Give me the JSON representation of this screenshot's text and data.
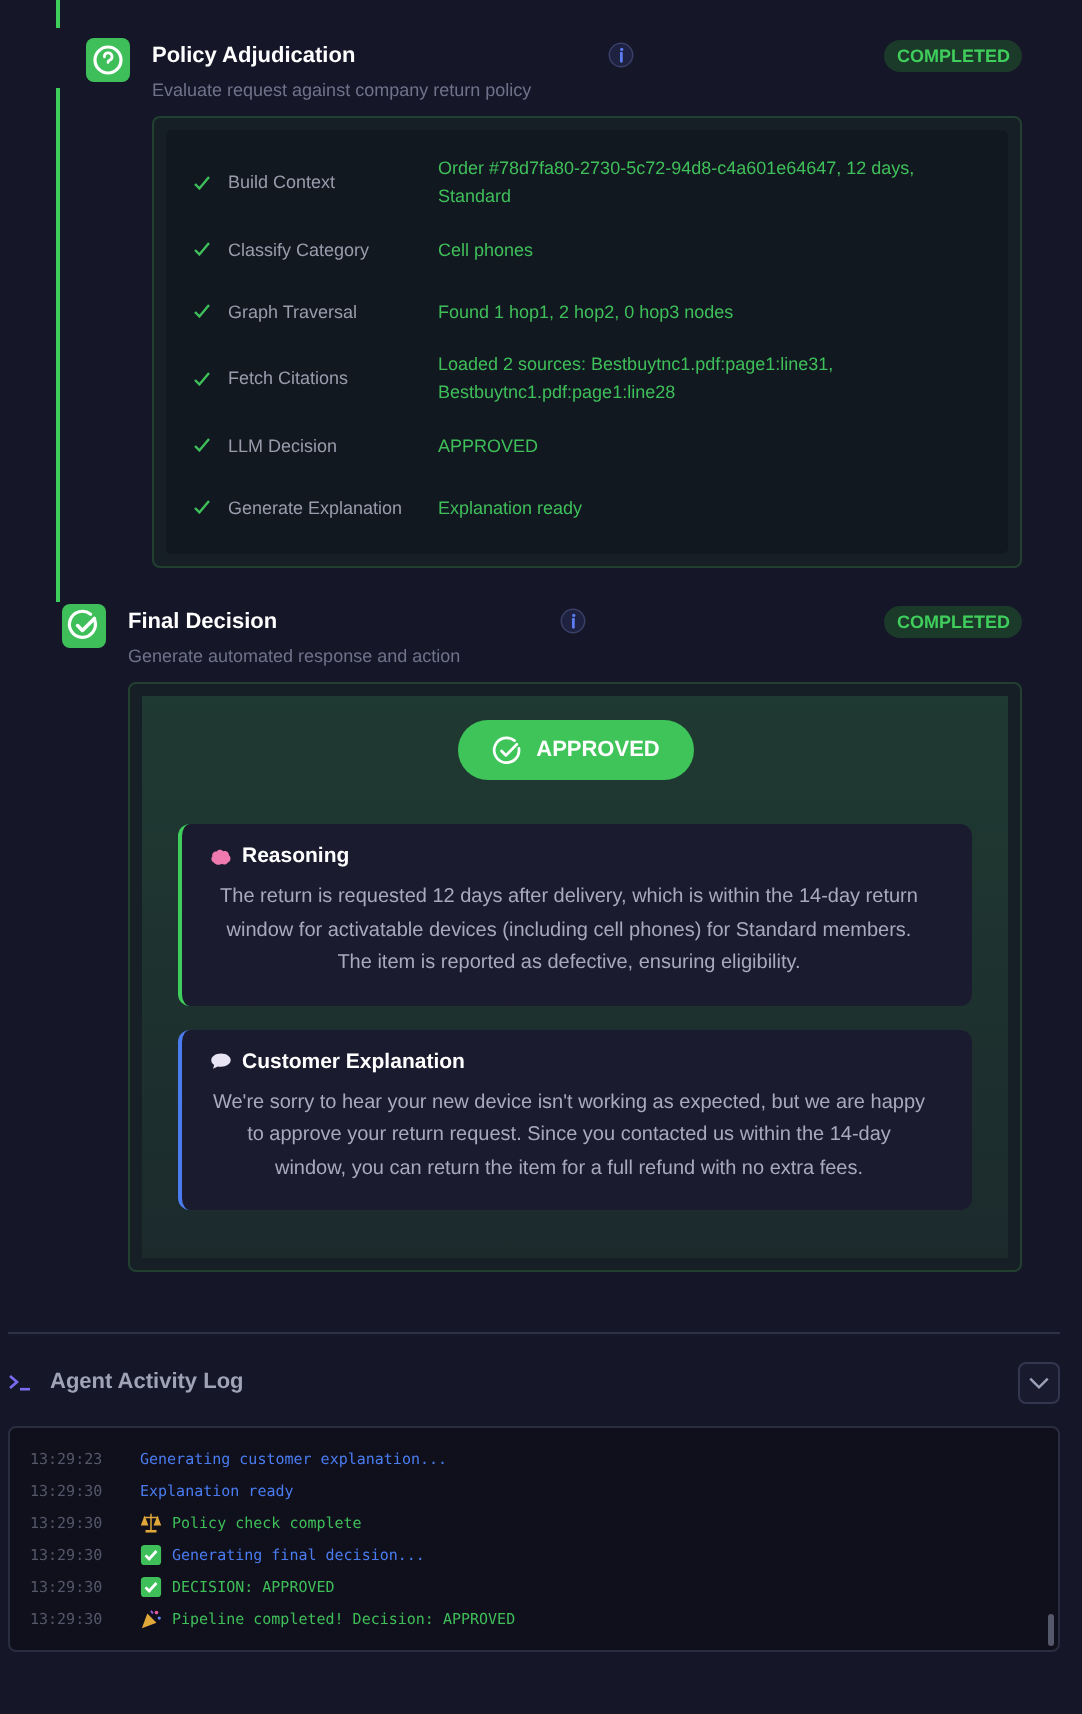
{
  "steps": [
    {
      "kind": "policy",
      "title": "Policy Adjudication",
      "subtitle": "Evaluate request against company return policy",
      "status": "COMPLETED",
      "rows": [
        {
          "done": true,
          "label": "Build Context",
          "value": "Order #78d7fa80-2730-5c72-94d8-c4a601e64647, 12 days, Standard"
        },
        {
          "done": true,
          "label": "Classify Category",
          "value": "Cell phones"
        },
        {
          "done": true,
          "label": "Graph Traversal",
          "value": "Found 1 hop1, 2 hop2, 0 hop3 nodes"
        },
        {
          "done": true,
          "label": "Fetch Citations",
          "value": "Loaded 2 sources: Bestbuytnc1.pdf:page1:line31, Bestbuytnc1.pdf:page1:line28"
        },
        {
          "done": true,
          "label": "LLM Decision",
          "value": "APPROVED"
        },
        {
          "done": true,
          "label": "Generate Explanation",
          "value": "Explanation ready"
        }
      ]
    },
    {
      "kind": "decision",
      "title": "Final Decision",
      "subtitle": "Generate automated response and action",
      "status": "COMPLETED",
      "verdict": "APPROVED",
      "sections": [
        {
          "kind": "reasoning",
          "title": "Reasoning",
          "text": "The return is requested 12 days after delivery, which is within the 14-day return window for activatable devices (including cell phones) for Standard members. The item is reported as defective, ensuring eligibility."
        },
        {
          "kind": "explanation",
          "title": "Customer Explanation",
          "text": "We're sorry to hear your new device isn't working as expected, but we are happy to approve your return request. Since you contacted us within the 14-day window, you can return the item for a full refund with no extra fees."
        }
      ]
    }
  ],
  "log": {
    "title": "Agent Activity Log",
    "entries": [
      {
        "time": "13:29:23",
        "text": "Generating customer explanation...",
        "color": "#4a7cf0",
        "kind": "plain"
      },
      {
        "time": "13:29:30",
        "text": "Explanation ready",
        "color": "#4a7cf0",
        "kind": "plain"
      },
      {
        "time": "13:29:30",
        "text": "Policy check complete",
        "color": "#3fbf5a",
        "kind": "scale"
      },
      {
        "time": "13:29:30",
        "text": "Generating final decision...",
        "color": "#4a7cf0",
        "kind": "check"
      },
      {
        "time": "13:29:30",
        "text": "DECISION: APPROVED",
        "color": "#3fbf5a",
        "kind": "check"
      },
      {
        "time": "13:29:30",
        "text": "Pipeline completed! Decision: APPROVED",
        "color": "#3fbf5a",
        "kind": "party"
      }
    ]
  }
}
